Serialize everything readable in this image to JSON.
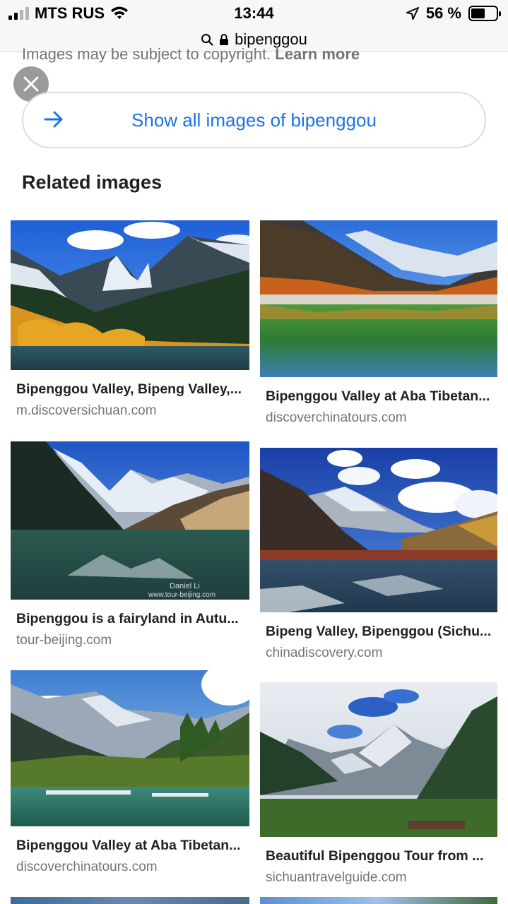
{
  "status_bar": {
    "carrier": "MTS RUS",
    "time": "13:44",
    "battery": "56 %",
    "battery_level": 0.56
  },
  "url_bar": {
    "domain": "bipenggou"
  },
  "copyright": {
    "text": "Images may be subject to copyright.",
    "link": "Learn more"
  },
  "show_all": {
    "label": "Show all images of bipenggou"
  },
  "related": {
    "heading": "Related images",
    "items": [
      {
        "title": "Bipenggou Valley, Bipeng Valley,...",
        "source": "m.discoversichuan.com"
      },
      {
        "title": "Bipenggou Valley at Aba Tibetan...",
        "source": "discoverchinatours.com"
      },
      {
        "title": "Bipenggou is a fairyland in Autu...",
        "source": "tour-beijing.com",
        "watermark": [
          "Daniel Li",
          "www.tour-beijing.com"
        ]
      },
      {
        "title": "Bipeng Valley, Bipenggou (Sichu...",
        "source": "chinadiscovery.com"
      },
      {
        "title": "Bipenggou Valley at Aba Tibetan...",
        "source": "discoverchinatours.com"
      },
      {
        "title": "Beautiful Bipenggou Tour from ...",
        "source": "sichuantravelguide.com"
      }
    ]
  },
  "colors": {
    "link_blue": "#1a73e8",
    "muted_gray": "#70757a"
  }
}
